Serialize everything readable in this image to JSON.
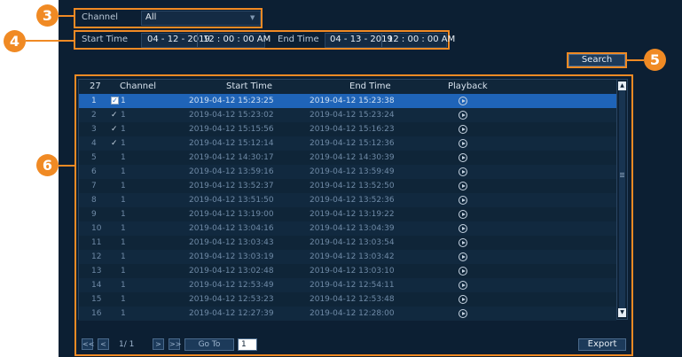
{
  "callouts": {
    "filter": "3",
    "time": "4",
    "search": "5",
    "table": "6"
  },
  "filters": {
    "channel_label": "Channel",
    "channel_value": "All",
    "start_label": "Start Time",
    "start_date": "04 - 12 - 2019",
    "start_time": "12 : 00 : 00 AM",
    "end_label": "End Time",
    "end_date": "04 - 13 - 2019",
    "end_time": "12 : 00 : 00 AM"
  },
  "search_label": "Search",
  "table": {
    "count": "27",
    "headers": {
      "channel": "Channel",
      "start": "Start Time",
      "end": "End Time",
      "playback": "Playback"
    },
    "rows": [
      {
        "idx": "1",
        "channel": "1",
        "start": "2019-04-12 15:23:25",
        "end": "2019-04-12 15:23:38",
        "mark": "checkbox"
      },
      {
        "idx": "2",
        "channel": "1",
        "start": "2019-04-12 15:23:02",
        "end": "2019-04-12 15:23:24",
        "mark": "tick"
      },
      {
        "idx": "3",
        "channel": "1",
        "start": "2019-04-12 15:15:56",
        "end": "2019-04-12 15:16:23",
        "mark": "tick"
      },
      {
        "idx": "4",
        "channel": "1",
        "start": "2019-04-12 15:12:14",
        "end": "2019-04-12 15:12:36",
        "mark": "tick"
      },
      {
        "idx": "5",
        "channel": "1",
        "start": "2019-04-12 14:30:17",
        "end": "2019-04-12 14:30:39",
        "mark": ""
      },
      {
        "idx": "6",
        "channel": "1",
        "start": "2019-04-12 13:59:16",
        "end": "2019-04-12 13:59:49",
        "mark": ""
      },
      {
        "idx": "7",
        "channel": "1",
        "start": "2019-04-12 13:52:37",
        "end": "2019-04-12 13:52:50",
        "mark": ""
      },
      {
        "idx": "8",
        "channel": "1",
        "start": "2019-04-12 13:51:50",
        "end": "2019-04-12 13:52:36",
        "mark": ""
      },
      {
        "idx": "9",
        "channel": "1",
        "start": "2019-04-12 13:19:00",
        "end": "2019-04-12 13:19:22",
        "mark": ""
      },
      {
        "idx": "10",
        "channel": "1",
        "start": "2019-04-12 13:04:16",
        "end": "2019-04-12 13:04:39",
        "mark": ""
      },
      {
        "idx": "11",
        "channel": "1",
        "start": "2019-04-12 13:03:43",
        "end": "2019-04-12 13:03:54",
        "mark": ""
      },
      {
        "idx": "12",
        "channel": "1",
        "start": "2019-04-12 13:03:19",
        "end": "2019-04-12 13:03:42",
        "mark": ""
      },
      {
        "idx": "13",
        "channel": "1",
        "start": "2019-04-12 13:02:48",
        "end": "2019-04-12 13:03:10",
        "mark": ""
      },
      {
        "idx": "14",
        "channel": "1",
        "start": "2019-04-12 12:53:49",
        "end": "2019-04-12 12:54:11",
        "mark": ""
      },
      {
        "idx": "15",
        "channel": "1",
        "start": "2019-04-12 12:53:23",
        "end": "2019-04-12 12:53:48",
        "mark": ""
      },
      {
        "idx": "16",
        "channel": "1",
        "start": "2019-04-12 12:27:39",
        "end": "2019-04-12 12:28:00",
        "mark": ""
      }
    ]
  },
  "pagination": {
    "first": "<<",
    "prev": "<",
    "page_text": "1/ 1",
    "next": ">",
    "last": ">>",
    "goto_label": "Go To",
    "goto_value": "1"
  },
  "export_label": "Export",
  "colors": {
    "accent": "#f08a24",
    "panel": "#0c1f33",
    "selected_row": "#1f64b8"
  },
  "icons": {
    "playback": "play-circle-icon",
    "dropdown": "caret-down-icon",
    "scroll_up": "arrow-up-icon",
    "scroll_down": "arrow-down-icon"
  }
}
